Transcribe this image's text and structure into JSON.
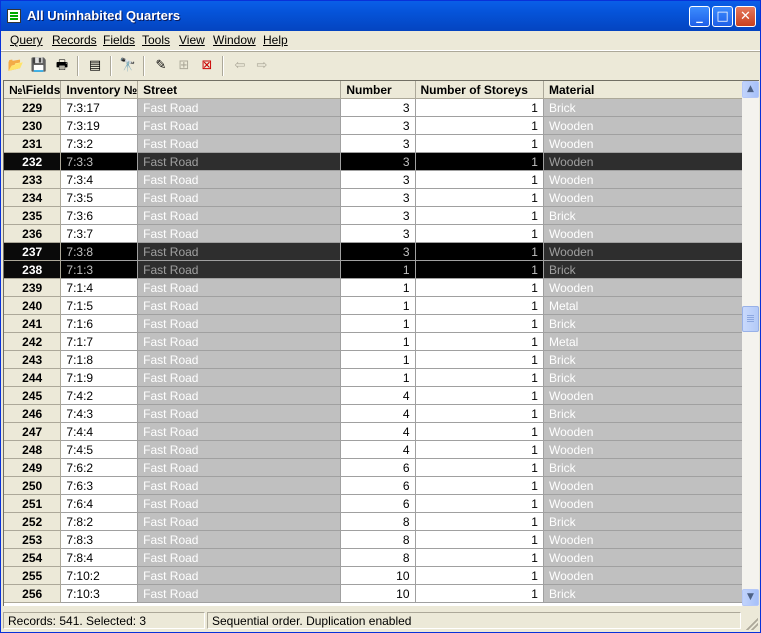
{
  "window": {
    "title": "All Uninhabited Quarters"
  },
  "menu": [
    "Query",
    "Records",
    "Fields",
    "Tools",
    "View",
    "Window",
    "Help"
  ],
  "toolbar": {
    "icons": [
      "open-folder-icon",
      "save-icon",
      "print-icon",
      "properties-icon",
      "find-icon",
      "edit-record-icon",
      "add-record-icon",
      "delete-record-icon",
      "undo-icon",
      "redo-icon"
    ]
  },
  "grid": {
    "headers": {
      "rownum": "№\\Fields",
      "inventory": "Inventory №",
      "street": "Street",
      "number": "Number",
      "storeys": "Number of Storeys",
      "material": "Material"
    },
    "rows": [
      {
        "n": "229",
        "inv": "7:3:17",
        "street": "Fast Road",
        "num": "3",
        "sto": "1",
        "mat": "Brick",
        "sel": false
      },
      {
        "n": "230",
        "inv": "7:3:19",
        "street": "Fast Road",
        "num": "3",
        "sto": "1",
        "mat": "Wooden",
        "sel": false
      },
      {
        "n": "231",
        "inv": "7:3:2",
        "street": "Fast Road",
        "num": "3",
        "sto": "1",
        "mat": "Wooden",
        "sel": false
      },
      {
        "n": "232",
        "inv": "7:3:3",
        "street": "Fast Road",
        "num": "3",
        "sto": "1",
        "mat": "Wooden",
        "sel": true
      },
      {
        "n": "233",
        "inv": "7:3:4",
        "street": "Fast Road",
        "num": "3",
        "sto": "1",
        "mat": "Wooden",
        "sel": false
      },
      {
        "n": "234",
        "inv": "7:3:5",
        "street": "Fast Road",
        "num": "3",
        "sto": "1",
        "mat": "Wooden",
        "sel": false
      },
      {
        "n": "235",
        "inv": "7:3:6",
        "street": "Fast Road",
        "num": "3",
        "sto": "1",
        "mat": "Brick",
        "sel": false
      },
      {
        "n": "236",
        "inv": "7:3:7",
        "street": "Fast Road",
        "num": "3",
        "sto": "1",
        "mat": "Wooden",
        "sel": false
      },
      {
        "n": "237",
        "inv": "7:3:8",
        "street": "Fast Road",
        "num": "3",
        "sto": "1",
        "mat": "Wooden",
        "sel": true
      },
      {
        "n": "238",
        "inv": "7:1:3",
        "street": "Fast Road",
        "num": "1",
        "sto": "1",
        "mat": "Brick",
        "sel": true
      },
      {
        "n": "239",
        "inv": "7:1:4",
        "street": "Fast Road",
        "num": "1",
        "sto": "1",
        "mat": "Wooden",
        "sel": false
      },
      {
        "n": "240",
        "inv": "7:1:5",
        "street": "Fast Road",
        "num": "1",
        "sto": "1",
        "mat": "Metal",
        "sel": false
      },
      {
        "n": "241",
        "inv": "7:1:6",
        "street": "Fast Road",
        "num": "1",
        "sto": "1",
        "mat": "Brick",
        "sel": false
      },
      {
        "n": "242",
        "inv": "7:1:7",
        "street": "Fast Road",
        "num": "1",
        "sto": "1",
        "mat": "Metal",
        "sel": false
      },
      {
        "n": "243",
        "inv": "7:1:8",
        "street": "Fast Road",
        "num": "1",
        "sto": "1",
        "mat": "Brick",
        "sel": false
      },
      {
        "n": "244",
        "inv": "7:1:9",
        "street": "Fast Road",
        "num": "1",
        "sto": "1",
        "mat": "Brick",
        "sel": false
      },
      {
        "n": "245",
        "inv": "7:4:2",
        "street": "Fast Road",
        "num": "4",
        "sto": "1",
        "mat": "Wooden",
        "sel": false
      },
      {
        "n": "246",
        "inv": "7:4:3",
        "street": "Fast Road",
        "num": "4",
        "sto": "1",
        "mat": "Brick",
        "sel": false
      },
      {
        "n": "247",
        "inv": "7:4:4",
        "street": "Fast Road",
        "num": "4",
        "sto": "1",
        "mat": "Wooden",
        "sel": false
      },
      {
        "n": "248",
        "inv": "7:4:5",
        "street": "Fast Road",
        "num": "4",
        "sto": "1",
        "mat": "Wooden",
        "sel": false
      },
      {
        "n": "249",
        "inv": "7:6:2",
        "street": "Fast Road",
        "num": "6",
        "sto": "1",
        "mat": "Brick",
        "sel": false
      },
      {
        "n": "250",
        "inv": "7:6:3",
        "street": "Fast Road",
        "num": "6",
        "sto": "1",
        "mat": "Wooden",
        "sel": false
      },
      {
        "n": "251",
        "inv": "7:6:4",
        "street": "Fast Road",
        "num": "6",
        "sto": "1",
        "mat": "Wooden",
        "sel": false
      },
      {
        "n": "252",
        "inv": "7:8:2",
        "street": "Fast Road",
        "num": "8",
        "sto": "1",
        "mat": "Brick",
        "sel": false
      },
      {
        "n": "253",
        "inv": "7:8:3",
        "street": "Fast Road",
        "num": "8",
        "sto": "1",
        "mat": "Wooden",
        "sel": false
      },
      {
        "n": "254",
        "inv": "7:8:4",
        "street": "Fast Road",
        "num": "8",
        "sto": "1",
        "mat": "Wooden",
        "sel": false
      },
      {
        "n": "255",
        "inv": "7:10:2",
        "street": "Fast Road",
        "num": "10",
        "sto": "1",
        "mat": "Wooden",
        "sel": false
      },
      {
        "n": "256",
        "inv": "7:10:3",
        "street": "Fast Road",
        "num": "10",
        "sto": "1",
        "mat": "Brick",
        "sel": false
      }
    ]
  },
  "status": {
    "records": "Records: 541. Selected: 3",
    "order": "Sequential order. Duplication enabled"
  }
}
